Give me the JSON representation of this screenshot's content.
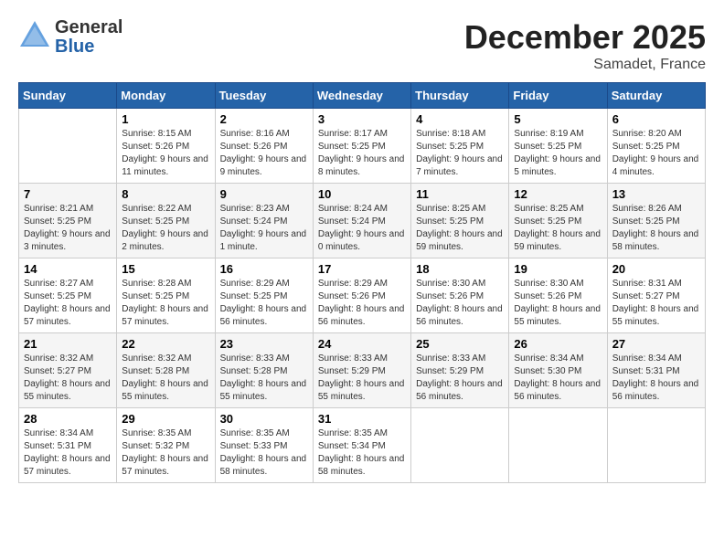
{
  "header": {
    "logo": {
      "general": "General",
      "blue": "Blue"
    },
    "title": "December 2025",
    "subtitle": "Samadet, France"
  },
  "days_of_week": [
    "Sunday",
    "Monday",
    "Tuesday",
    "Wednesday",
    "Thursday",
    "Friday",
    "Saturday"
  ],
  "weeks": [
    [
      {
        "day": "",
        "info": ""
      },
      {
        "day": "1",
        "info": "Sunrise: 8:15 AM\nSunset: 5:26 PM\nDaylight: 9 hours\nand 11 minutes."
      },
      {
        "day": "2",
        "info": "Sunrise: 8:16 AM\nSunset: 5:26 PM\nDaylight: 9 hours\nand 9 minutes."
      },
      {
        "day": "3",
        "info": "Sunrise: 8:17 AM\nSunset: 5:25 PM\nDaylight: 9 hours\nand 8 minutes."
      },
      {
        "day": "4",
        "info": "Sunrise: 8:18 AM\nSunset: 5:25 PM\nDaylight: 9 hours\nand 7 minutes."
      },
      {
        "day": "5",
        "info": "Sunrise: 8:19 AM\nSunset: 5:25 PM\nDaylight: 9 hours\nand 5 minutes."
      },
      {
        "day": "6",
        "info": "Sunrise: 8:20 AM\nSunset: 5:25 PM\nDaylight: 9 hours\nand 4 minutes."
      }
    ],
    [
      {
        "day": "7",
        "info": "Sunrise: 8:21 AM\nSunset: 5:25 PM\nDaylight: 9 hours\nand 3 minutes."
      },
      {
        "day": "8",
        "info": "Sunrise: 8:22 AM\nSunset: 5:25 PM\nDaylight: 9 hours\nand 2 minutes."
      },
      {
        "day": "9",
        "info": "Sunrise: 8:23 AM\nSunset: 5:24 PM\nDaylight: 9 hours\nand 1 minute."
      },
      {
        "day": "10",
        "info": "Sunrise: 8:24 AM\nSunset: 5:24 PM\nDaylight: 9 hours\nand 0 minutes."
      },
      {
        "day": "11",
        "info": "Sunrise: 8:25 AM\nSunset: 5:25 PM\nDaylight: 8 hours\nand 59 minutes."
      },
      {
        "day": "12",
        "info": "Sunrise: 8:25 AM\nSunset: 5:25 PM\nDaylight: 8 hours\nand 59 minutes."
      },
      {
        "day": "13",
        "info": "Sunrise: 8:26 AM\nSunset: 5:25 PM\nDaylight: 8 hours\nand 58 minutes."
      }
    ],
    [
      {
        "day": "14",
        "info": "Sunrise: 8:27 AM\nSunset: 5:25 PM\nDaylight: 8 hours\nand 57 minutes."
      },
      {
        "day": "15",
        "info": "Sunrise: 8:28 AM\nSunset: 5:25 PM\nDaylight: 8 hours\nand 57 minutes."
      },
      {
        "day": "16",
        "info": "Sunrise: 8:29 AM\nSunset: 5:25 PM\nDaylight: 8 hours\nand 56 minutes."
      },
      {
        "day": "17",
        "info": "Sunrise: 8:29 AM\nSunset: 5:26 PM\nDaylight: 8 hours\nand 56 minutes."
      },
      {
        "day": "18",
        "info": "Sunrise: 8:30 AM\nSunset: 5:26 PM\nDaylight: 8 hours\nand 56 minutes."
      },
      {
        "day": "19",
        "info": "Sunrise: 8:30 AM\nSunset: 5:26 PM\nDaylight: 8 hours\nand 55 minutes."
      },
      {
        "day": "20",
        "info": "Sunrise: 8:31 AM\nSunset: 5:27 PM\nDaylight: 8 hours\nand 55 minutes."
      }
    ],
    [
      {
        "day": "21",
        "info": "Sunrise: 8:32 AM\nSunset: 5:27 PM\nDaylight: 8 hours\nand 55 minutes."
      },
      {
        "day": "22",
        "info": "Sunrise: 8:32 AM\nSunset: 5:28 PM\nDaylight: 8 hours\nand 55 minutes."
      },
      {
        "day": "23",
        "info": "Sunrise: 8:33 AM\nSunset: 5:28 PM\nDaylight: 8 hours\nand 55 minutes."
      },
      {
        "day": "24",
        "info": "Sunrise: 8:33 AM\nSunset: 5:29 PM\nDaylight: 8 hours\nand 55 minutes."
      },
      {
        "day": "25",
        "info": "Sunrise: 8:33 AM\nSunset: 5:29 PM\nDaylight: 8 hours\nand 56 minutes."
      },
      {
        "day": "26",
        "info": "Sunrise: 8:34 AM\nSunset: 5:30 PM\nDaylight: 8 hours\nand 56 minutes."
      },
      {
        "day": "27",
        "info": "Sunrise: 8:34 AM\nSunset: 5:31 PM\nDaylight: 8 hours\nand 56 minutes."
      }
    ],
    [
      {
        "day": "28",
        "info": "Sunrise: 8:34 AM\nSunset: 5:31 PM\nDaylight: 8 hours\nand 57 minutes."
      },
      {
        "day": "29",
        "info": "Sunrise: 8:35 AM\nSunset: 5:32 PM\nDaylight: 8 hours\nand 57 minutes."
      },
      {
        "day": "30",
        "info": "Sunrise: 8:35 AM\nSunset: 5:33 PM\nDaylight: 8 hours\nand 58 minutes."
      },
      {
        "day": "31",
        "info": "Sunrise: 8:35 AM\nSunset: 5:34 PM\nDaylight: 8 hours\nand 58 minutes."
      },
      {
        "day": "",
        "info": ""
      },
      {
        "day": "",
        "info": ""
      },
      {
        "day": "",
        "info": ""
      }
    ]
  ]
}
